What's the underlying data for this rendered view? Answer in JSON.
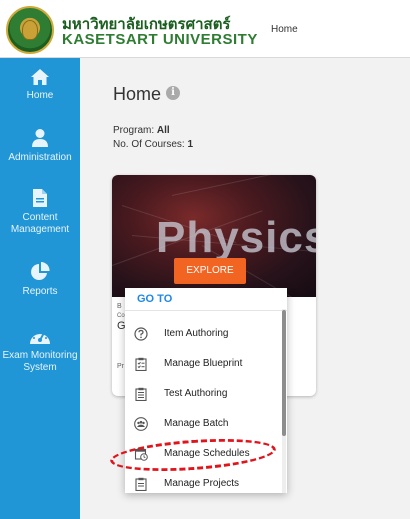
{
  "header": {
    "university_thai": "มหาวิทยาลัยเกษตรศาสตร์",
    "university_en": "KASETSART UNIVERSITY",
    "breadcrumb": "Home"
  },
  "sidebar": {
    "items": [
      {
        "label": "Home",
        "icon": "home-icon"
      },
      {
        "label": "Administration",
        "icon": "user-icon"
      },
      {
        "label": "Content Management",
        "icon": "document-icon"
      },
      {
        "label": "Reports",
        "icon": "pie-chart-icon"
      },
      {
        "label": "Exam Monitoring System",
        "icon": "dashboard-gauge-icon"
      }
    ]
  },
  "main": {
    "title": "Home",
    "program_label": "Program:",
    "program_value": "All",
    "courses_label": "No. Of Courses:",
    "courses_value": "1"
  },
  "card": {
    "image_text": "Physics",
    "explore_label": "EXPLORE",
    "partial_line_1": "B",
    "partial_line_2": "Co",
    "partial_line_3": "G",
    "partial_line_4": "Pr"
  },
  "menu": {
    "title": "GO TO",
    "items": [
      {
        "label": "Item Authoring",
        "icon": "question-circle-icon"
      },
      {
        "label": "Manage Blueprint",
        "icon": "clipboard-check-icon"
      },
      {
        "label": "Test Authoring",
        "icon": "clipboard-list-icon"
      },
      {
        "label": "Manage Batch",
        "icon": "group-icon"
      },
      {
        "label": "Manage Schedules",
        "icon": "calendar-clock-icon"
      },
      {
        "label": "Manage Projects",
        "icon": "clipboard-icon"
      }
    ]
  },
  "colors": {
    "sidebar": "#2196d6",
    "accent_orange": "#f26422",
    "menu_title": "#1e88e5",
    "highlight_ring": "#e0141b"
  }
}
